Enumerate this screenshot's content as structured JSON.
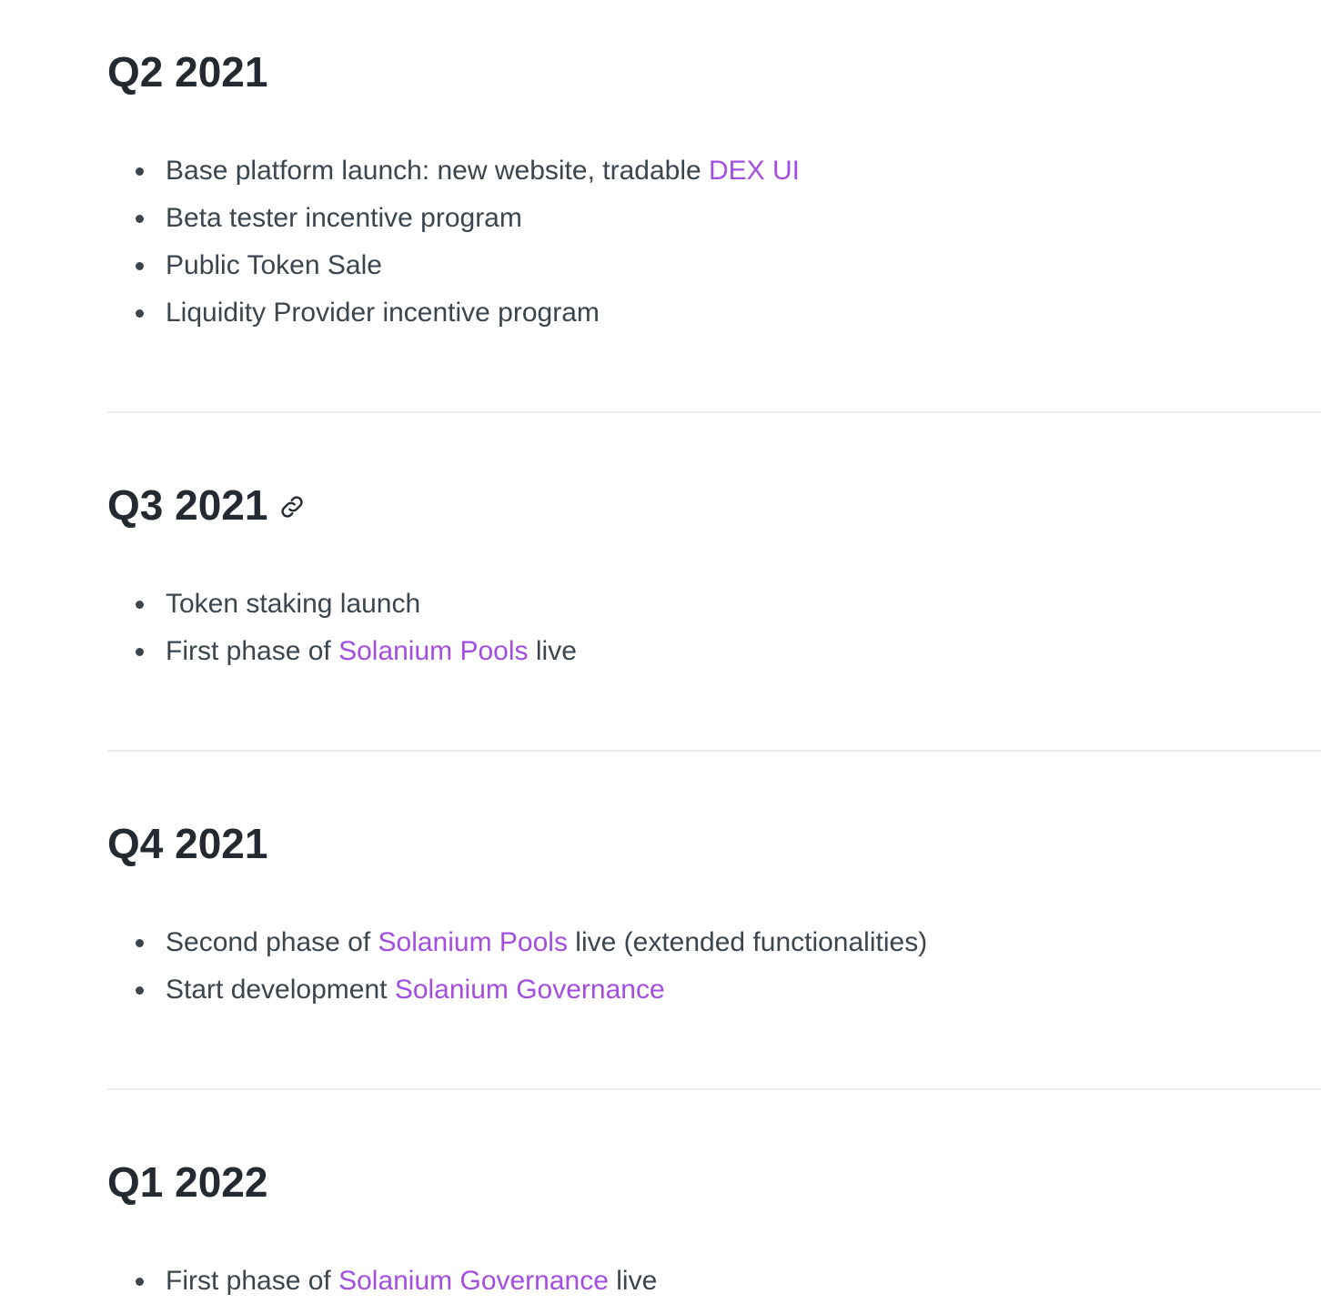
{
  "sections": [
    {
      "title": "Q2 2021",
      "items": [
        {
          "text_before": "Base platform launch: new website, tradable ",
          "link": "DEX UI",
          "text_after": ""
        },
        {
          "text_before": "Beta tester incentive program",
          "link": "",
          "text_after": ""
        },
        {
          "text_before": "Public Token Sale",
          "link": "",
          "text_after": ""
        },
        {
          "text_before": "Liquidity Provider incentive program",
          "link": "",
          "text_after": ""
        }
      ]
    },
    {
      "title": "Q3 2021",
      "show_anchor_icon": true,
      "items": [
        {
          "text_before": "Token staking launch",
          "link": "",
          "text_after": ""
        },
        {
          "text_before": "First phase of ",
          "link": "Solanium Pools",
          "text_after": " live"
        }
      ]
    },
    {
      "title": "Q4 2021",
      "items": [
        {
          "text_before": "Second phase of ",
          "link": "Solanium Pools",
          "text_after": " live (extended functionalities)"
        },
        {
          "text_before": "Start development ",
          "link": "Solanium Governance",
          "text_after": ""
        }
      ]
    },
    {
      "title": "Q1 2022",
      "items": [
        {
          "text_before": "First phase of ",
          "link": "Solanium Governance",
          "text_after": " live"
        }
      ]
    }
  ],
  "colors": {
    "heading": "#242a31",
    "body_text": "#3b454e",
    "link": "#a44ee0",
    "divider": "#e8eaec"
  },
  "icons": {
    "anchor": "link-icon"
  }
}
